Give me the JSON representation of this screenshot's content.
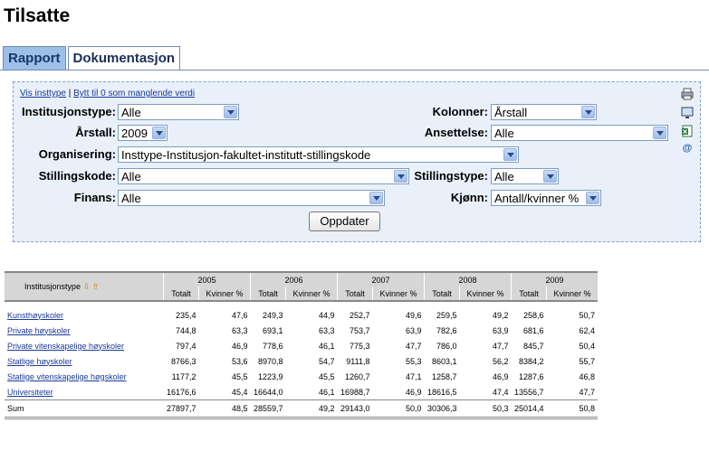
{
  "page_title": "Tilsatte",
  "tabs": [
    {
      "label": "Rapport"
    },
    {
      "label": "Dokumentasjon"
    }
  ],
  "panel": {
    "link_vis": "Vis insttype",
    "link_sep": "|",
    "link_bytt": "Bytt til 0 som manglende verdi",
    "fields": {
      "institusjonstype": {
        "label": "Institusjonstype:",
        "value": "Alle"
      },
      "kolonner": {
        "label": "Kolonner:",
        "value": "Årstall"
      },
      "arstall": {
        "label": "Årstall:",
        "value": "2009"
      },
      "ansettelse": {
        "label": "Ansettelse:",
        "value": "Alle"
      },
      "organisering": {
        "label": "Organisering:",
        "value": "Insttype-Institusjon-fakultet-institutt-stillingskode"
      },
      "stillingskode": {
        "label": "Stillingskode:",
        "value": "Alle"
      },
      "stillingstype": {
        "label": "Stillingstype:",
        "value": "Alle"
      },
      "finans": {
        "label": "Finans:",
        "value": "Alle"
      },
      "kjonn": {
        "label": "Kjønn:",
        "value": "Antall/kvinner %"
      }
    },
    "update_button": "Oppdater",
    "icons": [
      "print-icon",
      "monitor-icon",
      "excel-icon",
      "email-icon"
    ],
    "email_glyph": "@"
  },
  "table": {
    "row_header": "Institusjonstype",
    "sort_glyphs": "⇩ ⇧",
    "years": [
      "2005",
      "2006",
      "2007",
      "2008",
      "2009"
    ],
    "sub_headers": [
      "Totalt",
      "Kvinner %"
    ],
    "rows": [
      {
        "name": "Kunsthøyskoler",
        "values": [
          "235,4",
          "47,6",
          "249,3",
          "44,9",
          "252,7",
          "49,6",
          "259,5",
          "49,2",
          "258,6",
          "50,7"
        ]
      },
      {
        "name": "Private høyskoler",
        "values": [
          "744,8",
          "63,3",
          "693,1",
          "63,3",
          "753,7",
          "63,9",
          "782,6",
          "63,9",
          "681,6",
          "62,4"
        ]
      },
      {
        "name": "Private vitenskapelige høyskoler",
        "values": [
          "797,4",
          "46,9",
          "778,6",
          "46,1",
          "775,3",
          "47,7",
          "786,0",
          "47,7",
          "845,7",
          "50,4"
        ]
      },
      {
        "name": "Statlige høyskoler",
        "values": [
          "8766,3",
          "53,6",
          "8970,8",
          "54,7",
          "9111,8",
          "55,3",
          "8603,1",
          "56,2",
          "8384,2",
          "55,7"
        ]
      },
      {
        "name": "Statlige vitenskapelige høgskoler",
        "values": [
          "1177,2",
          "45,5",
          "1223,9",
          "45,5",
          "1260,7",
          "47,1",
          "1258,7",
          "46,9",
          "1287,6",
          "46,8"
        ]
      },
      {
        "name": "Universiteter",
        "values": [
          "16176,6",
          "45,4",
          "16644,0",
          "46,1",
          "16988,7",
          "46,9",
          "18616,5",
          "47,4",
          "13556,7",
          "47,7"
        ]
      }
    ],
    "sum": {
      "name": "Sum",
      "values": [
        "27897,7",
        "48,5",
        "28559,7",
        "49,2",
        "29143,0",
        "50,0",
        "30306,3",
        "50,3",
        "25014,4",
        "50,8"
      ]
    }
  }
}
